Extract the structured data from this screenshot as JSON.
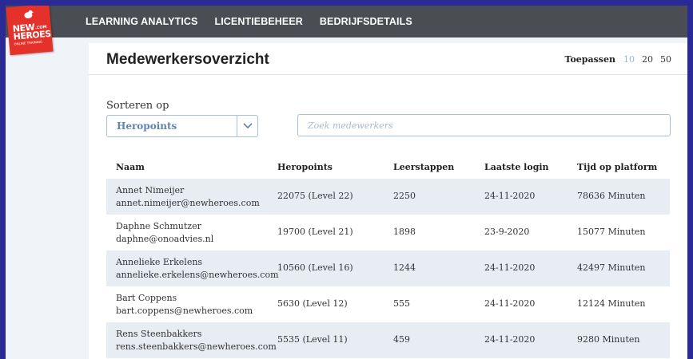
{
  "brand": {
    "line1": "NEW",
    "line2": "HEROES",
    "com": ".COM",
    "tagline": "ONLINE TRAINING",
    "primary_color": "#e4322b"
  },
  "nav": {
    "items": [
      {
        "label": "LEARNING ANALYTICS"
      },
      {
        "label": "LICENTIEBEHEER"
      },
      {
        "label": "BEDRIJFSDETAILS"
      }
    ]
  },
  "page": {
    "title": "Medewerkersoverzicht"
  },
  "pager": {
    "apply_label": "Toepassen",
    "options": [
      "10",
      "20",
      "50"
    ],
    "selected": "10"
  },
  "sort": {
    "label": "Sorteren op",
    "selected": "Heropoints",
    "icon": "chevron-down-icon"
  },
  "search": {
    "placeholder": "Zoek medewerkers",
    "value": ""
  },
  "table": {
    "columns": [
      "Naam",
      "Heropoints",
      "Leerstappen",
      "Laatste login",
      "Tijd op platform"
    ],
    "rows": [
      {
        "name": "Annet Nimeijer",
        "email": "annet.nimeijer@newheroes.com",
        "heropoints": "22075 (Level 22)",
        "steps": "2250",
        "last_login": "24-11-2020",
        "time": "78636 Minuten"
      },
      {
        "name": "Daphne Schmutzer",
        "email": "daphne@onoadvies.nl",
        "heropoints": "19700 (Level 21)",
        "steps": "1898",
        "last_login": "23-9-2020",
        "time": "15077 Minuten"
      },
      {
        "name": "Annelieke Erkelens",
        "email": "annelieke.erkelens@newheroes.com",
        "heropoints": "10560 (Level 16)",
        "steps": "1244",
        "last_login": "24-11-2020",
        "time": "42497 Minuten"
      },
      {
        "name": "Bart Coppens",
        "email": "bart.coppens@newheroes.com",
        "heropoints": "5630 (Level 12)",
        "steps": "555",
        "last_login": "24-11-2020",
        "time": "12124 Minuten"
      },
      {
        "name": "Rens Steenbakkers",
        "email": "rens.steenbakkers@newheroes.com",
        "heropoints": "5535 (Level 11)",
        "steps": "459",
        "last_login": "24-11-2020",
        "time": "9280 Minuten"
      }
    ]
  }
}
